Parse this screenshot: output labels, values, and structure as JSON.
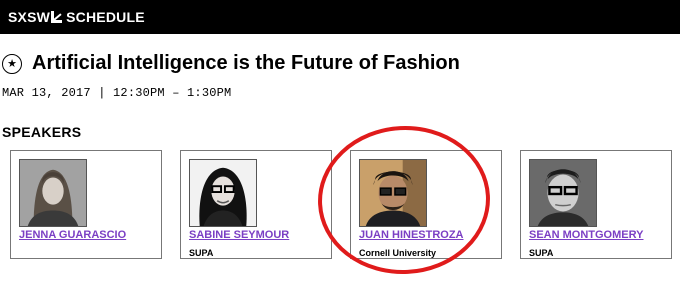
{
  "header": {
    "brand_left": "SXSW",
    "brand_right": "SCHEDULE"
  },
  "session": {
    "title": "Artificial Intelligence is the Future of Fashion",
    "datetime": "MAR 13, 2017 | 12:30PM – 1:30PM"
  },
  "speakers_heading": "SPEAKERS",
  "speakers": [
    {
      "name": "JENNA GUARASCIO",
      "org": ""
    },
    {
      "name": "SABINE SEYMOUR",
      "org": "SUPA"
    },
    {
      "name": "JUAN HINESTROZA",
      "org": "Cornell University"
    },
    {
      "name": "SEAN MONTGOMERY",
      "org": "SUPA"
    }
  ],
  "icons": {
    "favorite": "star-icon",
    "brand": "sxsw-logo-icon"
  },
  "colors": {
    "topbar": "#000000",
    "speaker_link": "#7b3fc4",
    "annotation": "#e01b1b"
  }
}
